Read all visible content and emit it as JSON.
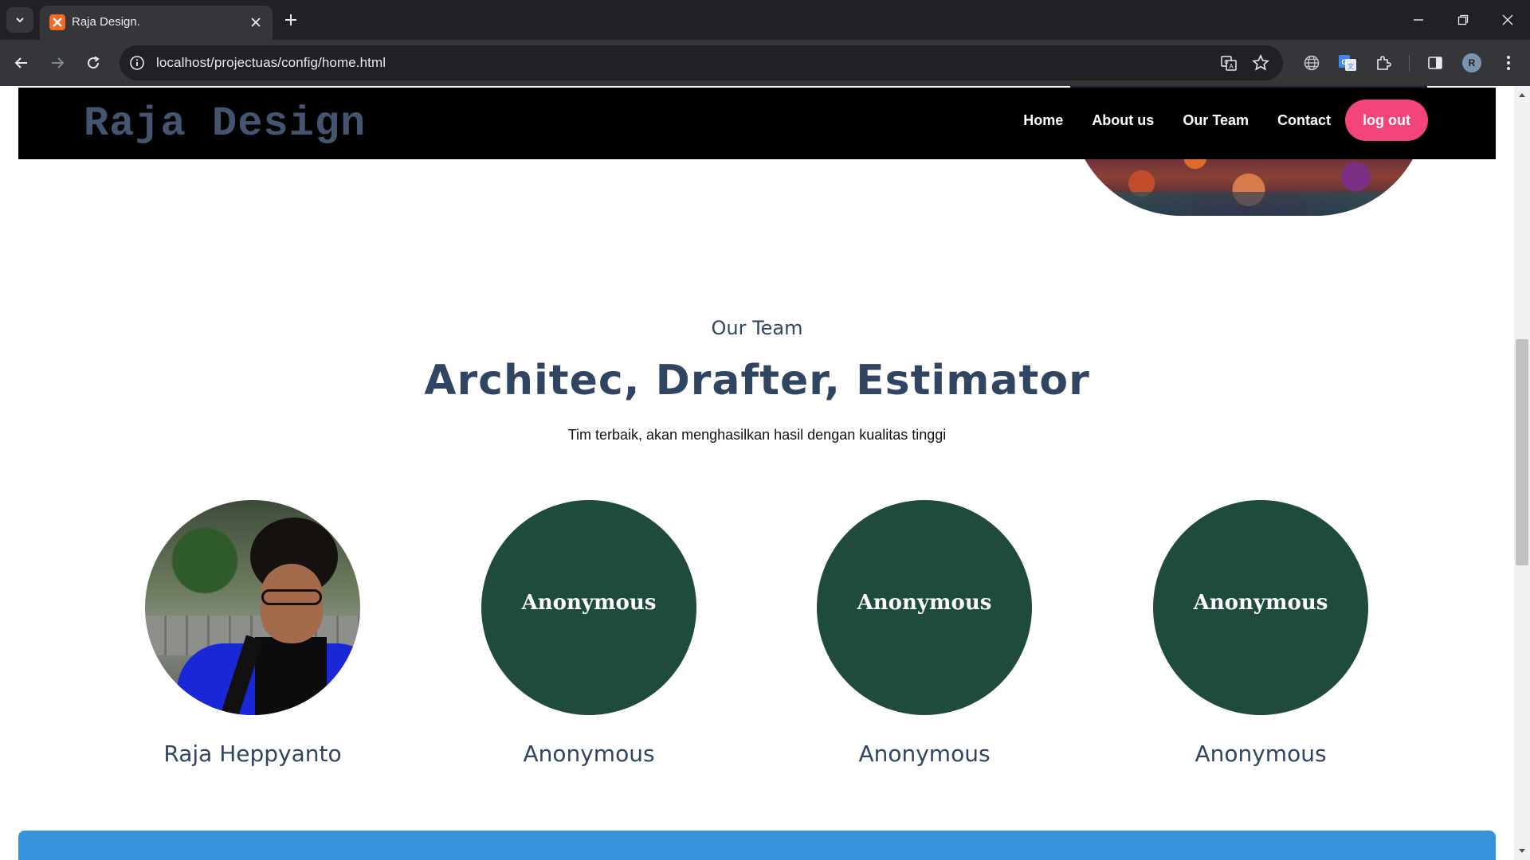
{
  "browser": {
    "tab": {
      "title": "Raja Design."
    },
    "address_bar": {
      "url": "localhost/projectuas/config/home.html"
    },
    "avatar_initial": "R",
    "colors": {
      "frame": "#202124",
      "toolbar": "#35363a",
      "text": "#e8eaed"
    }
  },
  "site": {
    "brand": "Raja Design",
    "nav": [
      {
        "label": "Home"
      },
      {
        "label": "About us"
      },
      {
        "label": "Our Team"
      },
      {
        "label": "Contact"
      }
    ],
    "logout_label": "log out",
    "colors": {
      "header": "#000000",
      "brand": "#44566f",
      "logout": "#f3457a",
      "footer": "#3593da"
    }
  },
  "team": {
    "eyebrow": "Our Team",
    "headline": "Architec, Drafter, Estimator",
    "tagline": "Tim terbaik, akan menghasilkan hasil dengan kualitas tinggi",
    "members": [
      {
        "name": "Raja Heppyanto",
        "photo": "portrait-photo"
      },
      {
        "name": "Anonymous",
        "circle_label": "Anonymous"
      },
      {
        "name": "Anonymous",
        "circle_label": "Anonymous"
      },
      {
        "name": "Anonymous",
        "circle_label": "Anonymous"
      }
    ],
    "colors": {
      "circle": "#1f4a3e",
      "heading": "#2f4562"
    }
  }
}
